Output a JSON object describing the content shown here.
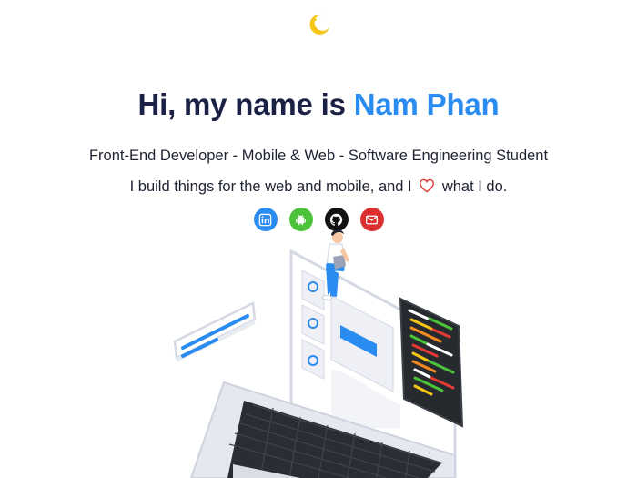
{
  "header": {
    "theme_toggle_icon": "moon-star-icon"
  },
  "hero": {
    "greeting": "Hi, my name is ",
    "name": "Nam Phan",
    "subtitle": "Front-End Developer - Mobile & Web - Software Engineering Student",
    "tagline_before": "I build things for the web and mobile, and I ",
    "tagline_after": " what I do.",
    "heart_icon": "heart-icon"
  },
  "socials": [
    {
      "icon": "linkedin-icon",
      "color": "#2a8cf0"
    },
    {
      "icon": "android-icon",
      "color": "#4cc23a"
    },
    {
      "icon": "github-icon",
      "color": "#111111"
    },
    {
      "icon": "mail-icon",
      "color": "#dc2f2f"
    }
  ],
  "colors": {
    "accent": "#2a8cf0",
    "title": "#1b2144",
    "heart": "#e53935"
  }
}
